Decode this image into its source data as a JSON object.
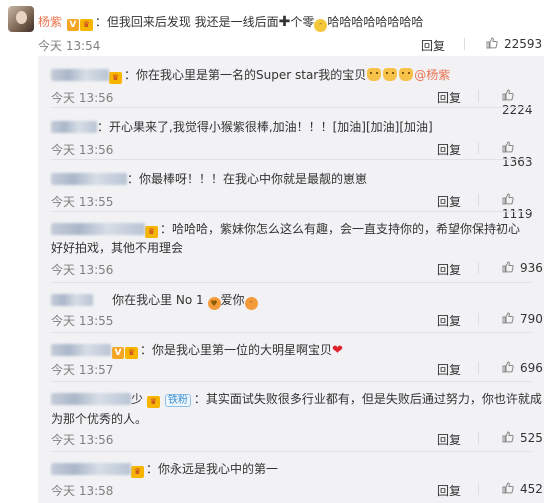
{
  "main_comment": {
    "username": "杨紫",
    "text_part1": "：但我回来后发现 我还是一线后面",
    "text_part2": "个零",
    "text_part3": "哈哈哈哈哈哈哈哈",
    "time": "今天 13:54",
    "reply_label": "回复",
    "likes": "22593"
  },
  "replies": [
    {
      "text": "你在我心里是第一名的Super star我的宝贝",
      "mention": "@杨紫",
      "time": "今天 13:56",
      "reply_label": "回复",
      "likes": "2224"
    },
    {
      "text": "：开心果来了,我觉得小猴紫很棒,加油！！！[加油][加油][加油]",
      "time": "今天 13:56",
      "reply_label": "回复",
      "likes": "1363"
    },
    {
      "text": "：你最棒呀！！！在我心中你就是最靓的崽崽",
      "time": "今天 13:55",
      "reply_label": "回复",
      "likes": "1119"
    },
    {
      "text_line1": "：哈哈哈，紫妹你怎么这么有趣，会一直支持你的，希望你保持初心",
      "text_line2": "好好拍戏，其他不用理会",
      "time": "今天 13:56",
      "reply_label": "回复",
      "likes": "936"
    },
    {
      "text": "你在我心里 No 1",
      "text_b": "爱你",
      "time": "今天 13:55",
      "reply_label": "回复",
      "likes": "790"
    },
    {
      "text": "：你是我心里第一位的大明星啊宝贝",
      "time": "今天 13:57",
      "reply_label": "回复",
      "likes": "696"
    },
    {
      "name_suffix": "少",
      "badge": "铁粉",
      "text_line1": "：其实面试失败很多行业都有，但是失败后通过努力，你也许就成",
      "text_line2": "为那个优秀的人。",
      "time": "今天 13:56",
      "reply_label": "回复",
      "likes": "525"
    },
    {
      "text": "：你永远是我心中的第一",
      "time": "今天 13:58",
      "reply_label": "回复",
      "likes": "452"
    }
  ],
  "icons": {
    "like": "thumbs-up-icon",
    "verified": "v-badge-icon",
    "crown": "crown-icon"
  }
}
